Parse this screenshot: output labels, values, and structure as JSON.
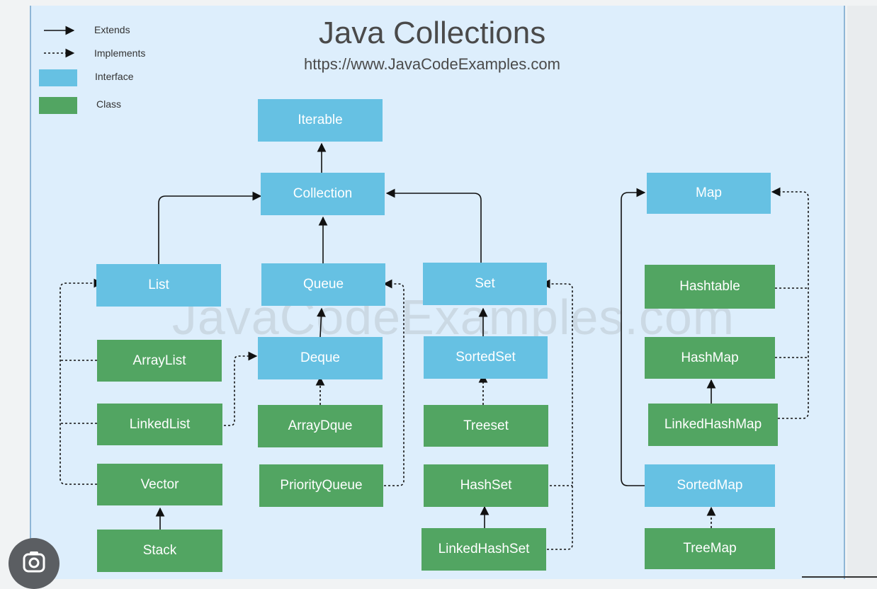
{
  "title": "Java Collections",
  "subtitle": "https://www.JavaCodeExamples.com",
  "watermark": "JavaCodeExamples.com",
  "legend": {
    "extends": "Extends",
    "implements": "Implements",
    "interface": "Interface",
    "class": "Class"
  },
  "colors": {
    "interface": "#66c1e3",
    "class": "#52a562",
    "background": "#ddeefc"
  },
  "nodes": {
    "iterable": "Iterable",
    "collection": "Collection",
    "list": "List",
    "queue": "Queue",
    "set": "Set",
    "map": "Map",
    "arraylist": "ArrayList",
    "linkedlist": "LinkedList",
    "vector": "Vector",
    "stack": "Stack",
    "deque": "Deque",
    "arraydque": "ArrayDque",
    "priorityqueue": "PriorityQueue",
    "sortedset": "SortedSet",
    "treeset": "Treeset",
    "hashset": "HashSet",
    "linkedhashset": "LinkedHashSet",
    "hashtable": "Hashtable",
    "hashmap": "HashMap",
    "linkedhashmap": "LinkedHashMap",
    "sortedmap": "SortedMap",
    "treemap": "TreeMap"
  },
  "edges": [
    {
      "from": "Collection",
      "to": "Iterable",
      "kind": "extends"
    },
    {
      "from": "List",
      "to": "Collection",
      "kind": "extends"
    },
    {
      "from": "Queue",
      "to": "Collection",
      "kind": "extends"
    },
    {
      "from": "Set",
      "to": "Collection",
      "kind": "extends"
    },
    {
      "from": "Deque",
      "to": "Queue",
      "kind": "extends"
    },
    {
      "from": "SortedSet",
      "to": "Set",
      "kind": "extends"
    },
    {
      "from": "Stack",
      "to": "Vector",
      "kind": "extends"
    },
    {
      "from": "LinkedHashSet",
      "to": "HashSet",
      "kind": "extends"
    },
    {
      "from": "LinkedHashMap",
      "to": "HashMap",
      "kind": "extends"
    },
    {
      "from": "SortedMap",
      "to": "Map",
      "kind": "extends"
    },
    {
      "from": "ArrayList",
      "to": "List",
      "kind": "implements"
    },
    {
      "from": "LinkedList",
      "to": "List",
      "kind": "implements"
    },
    {
      "from": "Vector",
      "to": "List",
      "kind": "implements"
    },
    {
      "from": "LinkedList",
      "to": "Deque",
      "kind": "implements"
    },
    {
      "from": "ArrayDque",
      "to": "Deque",
      "kind": "implements"
    },
    {
      "from": "PriorityQueue",
      "to": "Queue",
      "kind": "implements"
    },
    {
      "from": "Treeset",
      "to": "SortedSet",
      "kind": "implements"
    },
    {
      "from": "HashSet",
      "to": "Set",
      "kind": "implements"
    },
    {
      "from": "LinkedHashSet",
      "to": "Set",
      "kind": "implements"
    },
    {
      "from": "Hashtable",
      "to": "Map",
      "kind": "implements"
    },
    {
      "from": "HashMap",
      "to": "Map",
      "kind": "implements"
    },
    {
      "from": "LinkedHashMap",
      "to": "Map",
      "kind": "implements"
    },
    {
      "from": "TreeMap",
      "to": "SortedMap",
      "kind": "implements"
    }
  ],
  "overlay": {
    "lens_icon": "google-lens-icon"
  }
}
